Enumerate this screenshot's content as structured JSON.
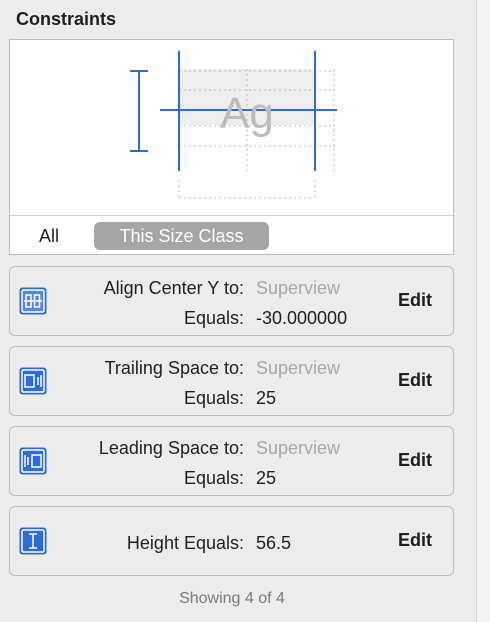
{
  "section": {
    "title": "Constraints"
  },
  "preview": {
    "sample_text": "Ag"
  },
  "size_class": {
    "all_label": "All",
    "this_label": "This Size Class",
    "selected": "This Size Class"
  },
  "constraints": [
    {
      "icon": "align-center-y-icon",
      "line1_label": "Align Center Y to:",
      "line1_value": "Superview",
      "line2_label": "Equals:",
      "line2_value": "-30.000000",
      "edit_label": "Edit"
    },
    {
      "icon": "trailing-space-icon",
      "line1_label": "Trailing Space to:",
      "line1_value": "Superview",
      "line2_label": "Equals:",
      "line2_value": "25",
      "edit_label": "Edit"
    },
    {
      "icon": "leading-space-icon",
      "line1_label": "Leading Space to:",
      "line1_value": "Superview",
      "line2_label": "Equals:",
      "line2_value": "25",
      "edit_label": "Edit"
    },
    {
      "icon": "height-icon",
      "line1_label": "Height Equals:",
      "line1_value": "56.5",
      "edit_label": "Edit"
    }
  ],
  "footer": {
    "status": "Showing 4 of 4"
  },
  "colors": {
    "accent": "#2d6bd6",
    "segment_selected": "#a6a6a6",
    "dim_text": "#a8a8a8"
  }
}
